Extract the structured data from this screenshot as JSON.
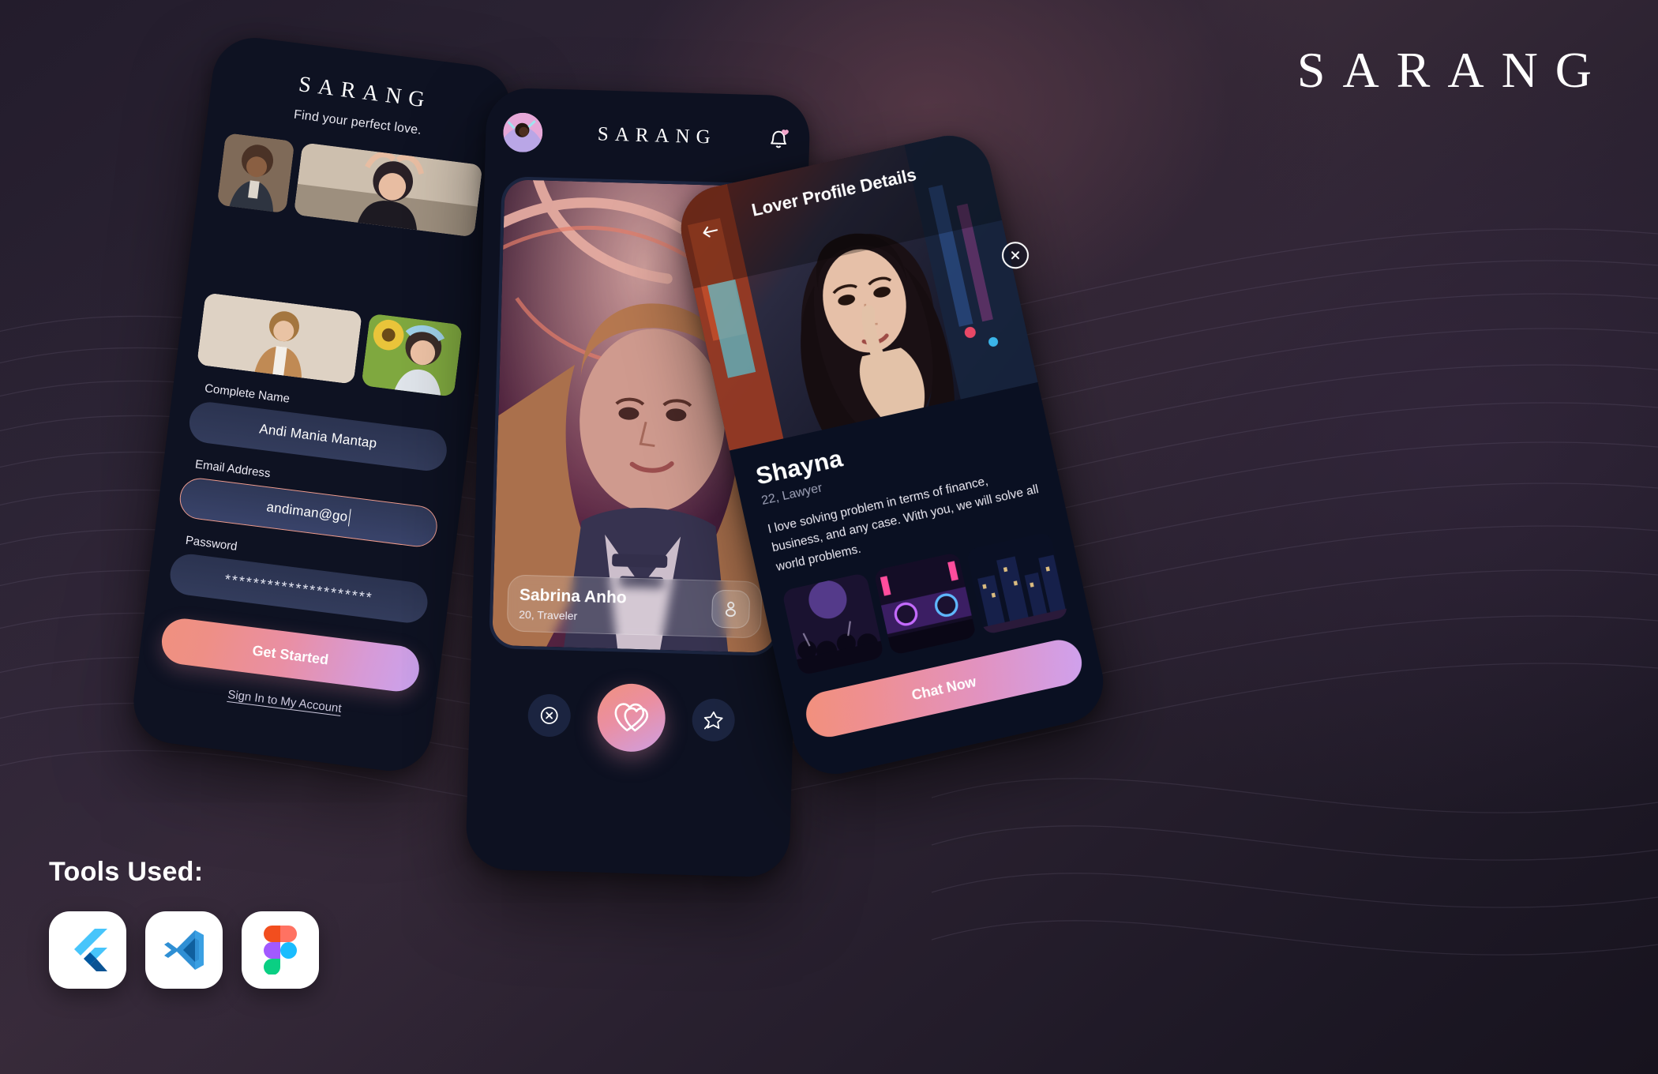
{
  "brand": {
    "wordmark": "SARANG"
  },
  "signup": {
    "logo": "SARANG",
    "tagline": "Find your perfect love.",
    "fields": [
      {
        "label": "Complete Name",
        "value": "Andi Mania Mantap",
        "placeholder": "Complete Name",
        "focused": false
      },
      {
        "label": "Email Address",
        "value": "andiman@go",
        "placeholder": "Email Address",
        "focused": true
      },
      {
        "label": "Password",
        "value": "*********************",
        "placeholder": "Password",
        "focused": false
      }
    ],
    "cta_label": "Get Started",
    "signin_label": "Sign In to My Account"
  },
  "swipe": {
    "logo": "SARANG",
    "avatar_icon": "user-avatar",
    "bell_icon": "notification-bell-icon",
    "card": {
      "name": "Sabrina Anho",
      "meta": "20, Traveler",
      "profile_icon": "person-icon"
    },
    "actions": [
      {
        "name": "dislike",
        "icon": "x-circle-icon"
      },
      {
        "name": "like",
        "icon": "double-heart-icon"
      },
      {
        "name": "superlike",
        "icon": "star-wand-icon"
      }
    ]
  },
  "profile": {
    "back_icon": "back-arrow-icon",
    "title": "Lover Profile Details",
    "close_icon": "close-circle-icon",
    "name": "Shayna",
    "meta": "22, Lawyer",
    "bio": "I love solving problem in terms of finance, business, and any case. With you, we will solve all world problems.",
    "gallery": [
      "concert-crowd",
      "dj-booth",
      "city-night"
    ],
    "cta_label": "Chat Now"
  },
  "tools": {
    "title": "Tools Used:",
    "items": [
      {
        "name": "flutter",
        "label": "Flutter"
      },
      {
        "name": "vscode",
        "label": "Visual Studio Code"
      },
      {
        "name": "figma",
        "label": "Figma"
      }
    ]
  },
  "colors": {
    "accent_start": "#f0917f",
    "accent_end": "#c9a2ee",
    "phone_bg": "#0e1222",
    "field_bg": "#333c5c",
    "focus_border": "#ef9d90"
  }
}
